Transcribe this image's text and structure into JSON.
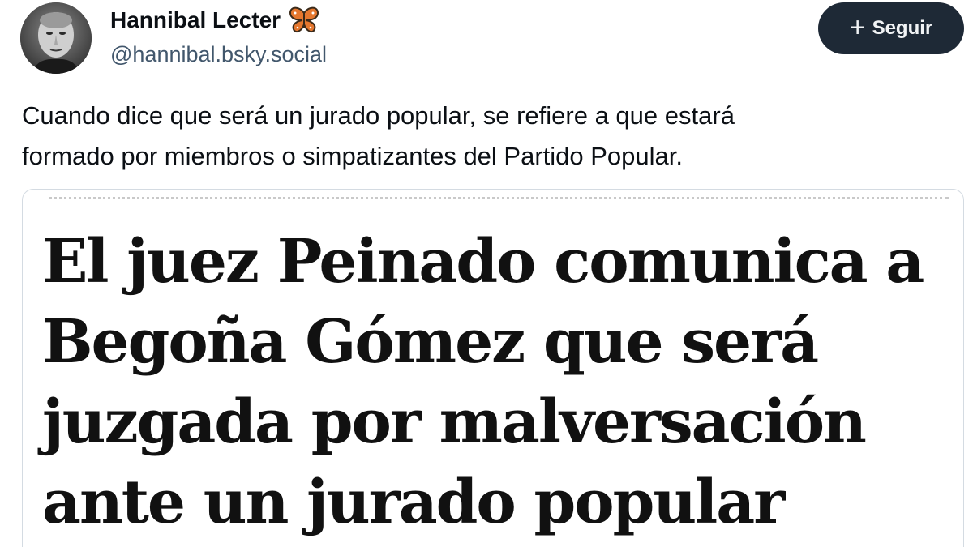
{
  "author": {
    "name": "Hannibal Lecter",
    "name_badge_icon": "butterfly-icon",
    "handle": "@hannibal.bsky.social",
    "avatar_icon": "avatar"
  },
  "follow_button": {
    "icon": "plus-icon",
    "label": "Seguir"
  },
  "post": {
    "text_lines": [
      "Cuando dice que será un jurado popular, se refiere a que estará",
      "formado por miembros o simpatizantes del Partido Popular."
    ]
  },
  "embed": {
    "headline_lines": [
      "El juez Peinado comunica a",
      "Begoña Gómez que será",
      "juzgada por malversación",
      "ante un jurado popular"
    ]
  },
  "colors": {
    "text": "#0b0f14",
    "handle": "#42576c",
    "button_bg": "#1e2936",
    "button_text": "#f1f3f5",
    "butterfly": "#e5772e"
  }
}
